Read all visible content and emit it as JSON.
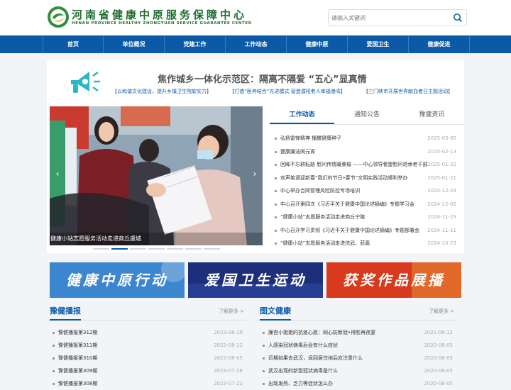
{
  "header": {
    "title_cn": "河南省健康中原服务保障中心",
    "title_en": "HENAN PROVINCE HEALTHY ZHONGYUAN SERVICE GUARANTEE CENTER",
    "search_placeholder": "请输入关键词"
  },
  "nav": [
    "首页",
    "单位概况",
    "党建工作",
    "工作动态",
    "健康中原",
    "爱国卫生",
    "健康促进"
  ],
  "feature": {
    "headline": "焦作城乡一体化示范区：隔离不隔爱 “五心”显真情",
    "subs": [
      "【以和谐文化建设，提升乡镇卫生院软实力】",
      "【打造“医养结合”先进模式 营造濮阳老人幸福港湾】",
      "【三门峡市开展世界献血者日主题活动】"
    ]
  },
  "carousel": {
    "caption": "健康小站志愿服务活动走进商丘虞城",
    "prev": "‹",
    "next": "›",
    "dots": 7,
    "active_dot": 1
  },
  "tabs": [
    "工作动态",
    "通知公告",
    "豫健资讯"
  ],
  "news": [
    {
      "title": "弘扬雷锋精神 播撒健康种子",
      "date": "2025-03-05"
    },
    {
      "title": "健康廉洁闹元宵",
      "date": "2025-02-13"
    },
    {
      "title": "回眸不忘耕耘路 慰问传情暖桑榆 ——中心领导看望慰问退休老干部",
      "date": "2025-01-22"
    },
    {
      "title": "欢声笑语迎新春“我们的节日•春节”文明实践活动顺利举办",
      "date": "2025-01-21"
    },
    {
      "title": "中心举办合同管理风险防控专场培训",
      "date": "2024-12-24"
    },
    {
      "title": "中心召开第四次《习近平关于健康中国论述摘编》专题学习会",
      "date": "2024-12-02"
    },
    {
      "title": "“健康小站”志愿服务活动走进商丘宁陵",
      "date": "2024-11-23"
    },
    {
      "title": "中心召开学习贯彻《习近平关于健康中国论述摘编》专题部署会",
      "date": "2024-11-11"
    },
    {
      "title": "“健康小站”志愿服务活动走进信武、获嘉",
      "date": "2024-10-23"
    }
  ],
  "banners": [
    {
      "text": "健康中原行动",
      "bg": "#2a6fc0",
      "fg": "#ffffff"
    },
    {
      "text": "爱国卫生运动",
      "bg": "#1d2f7a",
      "fg": "#ffffff"
    },
    {
      "text": "获奖作品展播",
      "bg": "#d73a1c",
      "fg": "#ffffff"
    }
  ],
  "left_col": {
    "title": "豫健播报",
    "more": "了解更多 >",
    "items": [
      {
        "title": "豫健播报第312期",
        "date": "2023-08-19"
      },
      {
        "title": "豫健播报第311期",
        "date": "2023-08-12"
      },
      {
        "title": "豫健播报第310期",
        "date": "2023-08-05"
      },
      {
        "title": "豫健播报第309期",
        "date": "2023-07-28"
      },
      {
        "title": "豫健播报第308期",
        "date": "2023-07-22"
      }
    ]
  },
  "right_col": {
    "title": "图文健康",
    "more": "了解更多 >",
    "items": [
      {
        "title": "廉宫小姐姐的抗疫心愿：同心防新冠•得胜再夜宴",
        "date": "2021-08-12"
      },
      {
        "title": "人感染冠状病毒后会有什么症状",
        "date": "2020-08-05"
      },
      {
        "title": "近期如果去武汉，返回居住地后应注意什么",
        "date": "2020-08-05"
      },
      {
        "title": "武汉出现的新型冠状病毒是什么",
        "date": "2020-08-05"
      },
      {
        "title": "出现发热、乏力等症状怎么办",
        "date": "2020-08-05"
      }
    ]
  },
  "colors": {
    "brand": "#0b5aa8",
    "logo_green": "#1e6f2e",
    "accent_cyan": "#2bb7c8"
  }
}
